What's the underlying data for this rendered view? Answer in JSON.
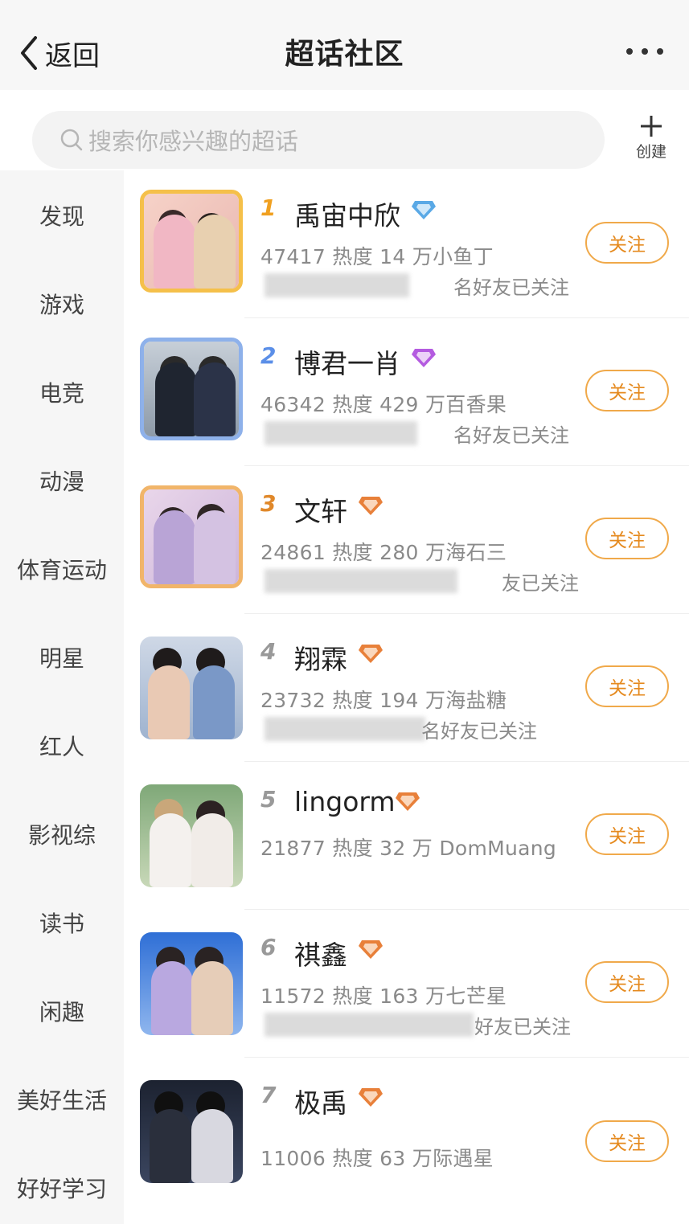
{
  "header": {
    "back_label": "返回",
    "title": "超话社区"
  },
  "search": {
    "placeholder": "搜索你感兴趣的超话",
    "create_label": "创建"
  },
  "sidebar": {
    "items": [
      "发现",
      "游戏",
      "电竞",
      "动漫",
      "体育运动",
      "明星",
      "红人",
      "影视综",
      "读书",
      "闲趣",
      "美好生活",
      "好好学习"
    ]
  },
  "list": {
    "items": [
      {
        "rank": "1",
        "name": "禹宙中欣",
        "stats": "47417 热度 14 万小鱼丁",
        "friends": "名好友已关注",
        "follow": "关注",
        "badge_color": "#5aa9e6",
        "rank_color": "#f0a020"
      },
      {
        "rank": "2",
        "name": "博君一肖",
        "stats": "46342 热度 429 万百香果",
        "friends": "名好友已关注",
        "follow": "关注",
        "badge_color": "#b45be0",
        "rank_color": "#5b8fe8"
      },
      {
        "rank": "3",
        "name": "文轩",
        "stats": "24861 热度 280 万海石三",
        "friends": "友已关注",
        "follow": "关注",
        "badge_color": "#e8803a",
        "rank_color": "#e0882a"
      },
      {
        "rank": "4",
        "name": "翔霖",
        "stats": "23732 热度 194 万海盐糖",
        "friends": "名好友已关注",
        "follow": "关注",
        "badge_color": "#e8803a",
        "rank_color": "#999999"
      },
      {
        "rank": "5",
        "name": "lingorm",
        "stats": "21877 热度 32 万 DomMuang",
        "friends": "",
        "follow": "关注",
        "badge_color": "#e8803a",
        "rank_color": "#999999"
      },
      {
        "rank": "6",
        "name": "祺鑫",
        "stats": "11572 热度 163 万七芒星",
        "friends": "好友已关注",
        "follow": "关注",
        "badge_color": "#e8803a",
        "rank_color": "#999999"
      },
      {
        "rank": "7",
        "name": "极禹",
        "stats": "11006 热度 63 万际遇星",
        "friends": "",
        "follow": "关注",
        "badge_color": "#e8803a",
        "rank_color": "#999999"
      }
    ]
  },
  "colors": {
    "accent": "#f0a94a",
    "follow_text": "#e58a1f",
    "sidebar_bg": "#f6f6f6"
  },
  "icons": {
    "back": "chevron-left-icon",
    "more": "more-dots-icon",
    "search": "search-icon",
    "create": "plus-icon",
    "badge": "diamond-badge-icon"
  }
}
